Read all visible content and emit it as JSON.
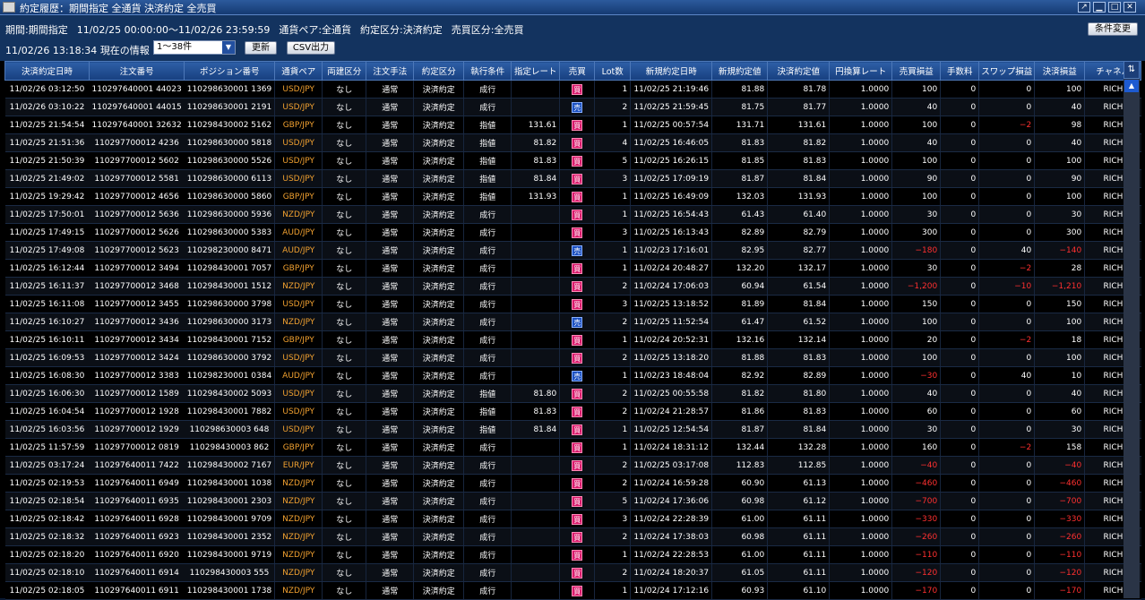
{
  "window": {
    "title": "約定履歴：期間指定 全通貨 決済約定 全売買"
  },
  "info": {
    "period_label": "期間:期間指定",
    "period_range": "11/02/25 00:00:00〜11/02/26 23:59:59",
    "currency": "通貨ペア:全通貨",
    "trade_type": "約定区分:決済約定",
    "side": "売買区分:全売買",
    "current_time": "11/02/26 13:18:34",
    "current_info_label": "現在の情報",
    "range_select": "1〜38件",
    "refresh_button": "更新",
    "csv_button": "CSV出力",
    "condition_button": "条件変更"
  },
  "columns": [
    "決済約定日時",
    "注文番号",
    "ポジション番号",
    "通貨ペア",
    "両建区分",
    "注文手法",
    "約定区分",
    "執行条件",
    "指定レート",
    "売買",
    "Lot数",
    "新規約定日時",
    "新規約定値",
    "決済約定値",
    "円換算レート",
    "売買損益",
    "手数料",
    "スワップ損益",
    "決済損益",
    "チャネル"
  ],
  "rows": [
    {
      "dt": "11/02/26 03:12:50",
      "order": "110297640001 44023",
      "pos": "110298630001 1369",
      "pair": "USD/JPY",
      "hedge": "なし",
      "method": "通常",
      "kind": "決済約定",
      "cond": "成行",
      "rate": "",
      "side": "買",
      "lot": "1",
      "open_dt": "11/02/25 21:19:46",
      "open": "81.88",
      "close": "81.78",
      "conv": "1.0000",
      "pl": "100",
      "fee": "0",
      "swap": "0",
      "net": "100",
      "ch": "RICH"
    },
    {
      "dt": "11/02/26 03:10:22",
      "order": "110297640001 44015",
      "pos": "110298630001 2191",
      "pair": "USD/JPY",
      "hedge": "なし",
      "method": "通常",
      "kind": "決済約定",
      "cond": "成行",
      "rate": "",
      "side": "売",
      "lot": "2",
      "open_dt": "11/02/25 21:59:45",
      "open": "81.75",
      "close": "81.77",
      "conv": "1.0000",
      "pl": "40",
      "fee": "0",
      "swap": "0",
      "net": "40",
      "ch": "RICH"
    },
    {
      "dt": "11/02/25 21:54:54",
      "order": "110297640001 32632",
      "pos": "110298430002 5162",
      "pair": "GBP/JPY",
      "hedge": "なし",
      "method": "通常",
      "kind": "決済約定",
      "cond": "指値",
      "rate": "131.61",
      "side": "買",
      "lot": "1",
      "open_dt": "11/02/25 00:57:54",
      "open": "131.71",
      "close": "131.61",
      "conv": "1.0000",
      "pl": "100",
      "fee": "0",
      "swap": "−2",
      "net": "98",
      "ch": "RICH"
    },
    {
      "dt": "11/02/25 21:51:36",
      "order": "110297700012 4236",
      "pos": "110298630000 5818",
      "pair": "USD/JPY",
      "hedge": "なし",
      "method": "通常",
      "kind": "決済約定",
      "cond": "指値",
      "rate": "81.82",
      "side": "買",
      "lot": "4",
      "open_dt": "11/02/25 16:46:05",
      "open": "81.83",
      "close": "81.82",
      "conv": "1.0000",
      "pl": "40",
      "fee": "0",
      "swap": "0",
      "net": "40",
      "ch": "RICH"
    },
    {
      "dt": "11/02/25 21:50:39",
      "order": "110297700012 5602",
      "pos": "110298630000 5526",
      "pair": "USD/JPY",
      "hedge": "なし",
      "method": "通常",
      "kind": "決済約定",
      "cond": "指値",
      "rate": "81.83",
      "side": "買",
      "lot": "5",
      "open_dt": "11/02/25 16:26:15",
      "open": "81.85",
      "close": "81.83",
      "conv": "1.0000",
      "pl": "100",
      "fee": "0",
      "swap": "0",
      "net": "100",
      "ch": "RICH"
    },
    {
      "dt": "11/02/25 21:49:02",
      "order": "110297700012 5581",
      "pos": "110298630000 6113",
      "pair": "USD/JPY",
      "hedge": "なし",
      "method": "通常",
      "kind": "決済約定",
      "cond": "指値",
      "rate": "81.84",
      "side": "買",
      "lot": "3",
      "open_dt": "11/02/25 17:09:19",
      "open": "81.87",
      "close": "81.84",
      "conv": "1.0000",
      "pl": "90",
      "fee": "0",
      "swap": "0",
      "net": "90",
      "ch": "RICH"
    },
    {
      "dt": "11/02/25 19:29:42",
      "order": "110297700012 4656",
      "pos": "110298630000 5860",
      "pair": "GBP/JPY",
      "hedge": "なし",
      "method": "通常",
      "kind": "決済約定",
      "cond": "指値",
      "rate": "131.93",
      "side": "買",
      "lot": "1",
      "open_dt": "11/02/25 16:49:09",
      "open": "132.03",
      "close": "131.93",
      "conv": "1.0000",
      "pl": "100",
      "fee": "0",
      "swap": "0",
      "net": "100",
      "ch": "RICH"
    },
    {
      "dt": "11/02/25 17:50:01",
      "order": "110297700012 5636",
      "pos": "110298630000 5936",
      "pair": "NZD/JPY",
      "hedge": "なし",
      "method": "通常",
      "kind": "決済約定",
      "cond": "成行",
      "rate": "",
      "side": "買",
      "lot": "1",
      "open_dt": "11/02/25 16:54:43",
      "open": "61.43",
      "close": "61.40",
      "conv": "1.0000",
      "pl": "30",
      "fee": "0",
      "swap": "0",
      "net": "30",
      "ch": "RICH"
    },
    {
      "dt": "11/02/25 17:49:15",
      "order": "110297700012 5626",
      "pos": "110298630000 5383",
      "pair": "AUD/JPY",
      "hedge": "なし",
      "method": "通常",
      "kind": "決済約定",
      "cond": "成行",
      "rate": "",
      "side": "買",
      "lot": "3",
      "open_dt": "11/02/25 16:13:43",
      "open": "82.89",
      "close": "82.79",
      "conv": "1.0000",
      "pl": "300",
      "fee": "0",
      "swap": "0",
      "net": "300",
      "ch": "RICH"
    },
    {
      "dt": "11/02/25 17:49:08",
      "order": "110297700012 5623",
      "pos": "110298230000 8471",
      "pair": "AUD/JPY",
      "hedge": "なし",
      "method": "通常",
      "kind": "決済約定",
      "cond": "成行",
      "rate": "",
      "side": "売",
      "lot": "1",
      "open_dt": "11/02/23 17:16:01",
      "open": "82.95",
      "close": "82.77",
      "conv": "1.0000",
      "pl": "−180",
      "fee": "0",
      "swap": "40",
      "net": "−140",
      "ch": "RICH"
    },
    {
      "dt": "11/02/25 16:12:44",
      "order": "110297700012 3494",
      "pos": "110298430001 7057",
      "pair": "GBP/JPY",
      "hedge": "なし",
      "method": "通常",
      "kind": "決済約定",
      "cond": "成行",
      "rate": "",
      "side": "買",
      "lot": "1",
      "open_dt": "11/02/24 20:48:27",
      "open": "132.20",
      "close": "132.17",
      "conv": "1.0000",
      "pl": "30",
      "fee": "0",
      "swap": "−2",
      "net": "28",
      "ch": "RICH"
    },
    {
      "dt": "11/02/25 16:11:37",
      "order": "110297700012 3468",
      "pos": "110298430001 1512",
      "pair": "NZD/JPY",
      "hedge": "なし",
      "method": "通常",
      "kind": "決済約定",
      "cond": "成行",
      "rate": "",
      "side": "買",
      "lot": "2",
      "open_dt": "11/02/24 17:06:03",
      "open": "60.94",
      "close": "61.54",
      "conv": "1.0000",
      "pl": "−1,200",
      "fee": "0",
      "swap": "−10",
      "net": "−1,210",
      "ch": "RICH"
    },
    {
      "dt": "11/02/25 16:11:08",
      "order": "110297700012 3455",
      "pos": "110298630000 3798",
      "pair": "USD/JPY",
      "hedge": "なし",
      "method": "通常",
      "kind": "決済約定",
      "cond": "成行",
      "rate": "",
      "side": "買",
      "lot": "3",
      "open_dt": "11/02/25 13:18:52",
      "open": "81.89",
      "close": "81.84",
      "conv": "1.0000",
      "pl": "150",
      "fee": "0",
      "swap": "0",
      "net": "150",
      "ch": "RICH"
    },
    {
      "dt": "11/02/25 16:10:27",
      "order": "110297700012 3436",
      "pos": "110298630000 3173",
      "pair": "NZD/JPY",
      "hedge": "なし",
      "method": "通常",
      "kind": "決済約定",
      "cond": "成行",
      "rate": "",
      "side": "売",
      "lot": "2",
      "open_dt": "11/02/25 11:52:54",
      "open": "61.47",
      "close": "61.52",
      "conv": "1.0000",
      "pl": "100",
      "fee": "0",
      "swap": "0",
      "net": "100",
      "ch": "RICH"
    },
    {
      "dt": "11/02/25 16:10:11",
      "order": "110297700012 3434",
      "pos": "110298430001 7152",
      "pair": "GBP/JPY",
      "hedge": "なし",
      "method": "通常",
      "kind": "決済約定",
      "cond": "成行",
      "rate": "",
      "side": "買",
      "lot": "1",
      "open_dt": "11/02/24 20:52:31",
      "open": "132.16",
      "close": "132.14",
      "conv": "1.0000",
      "pl": "20",
      "fee": "0",
      "swap": "−2",
      "net": "18",
      "ch": "RICH"
    },
    {
      "dt": "11/02/25 16:09:53",
      "order": "110297700012 3424",
      "pos": "110298630000 3792",
      "pair": "USD/JPY",
      "hedge": "なし",
      "method": "通常",
      "kind": "決済約定",
      "cond": "成行",
      "rate": "",
      "side": "買",
      "lot": "2",
      "open_dt": "11/02/25 13:18:20",
      "open": "81.88",
      "close": "81.83",
      "conv": "1.0000",
      "pl": "100",
      "fee": "0",
      "swap": "0",
      "net": "100",
      "ch": "RICH"
    },
    {
      "dt": "11/02/25 16:08:30",
      "order": "110297700012 3383",
      "pos": "110298230001 0384",
      "pair": "AUD/JPY",
      "hedge": "なし",
      "method": "通常",
      "kind": "決済約定",
      "cond": "成行",
      "rate": "",
      "side": "売",
      "lot": "1",
      "open_dt": "11/02/23 18:48:04",
      "open": "82.92",
      "close": "82.89",
      "conv": "1.0000",
      "pl": "−30",
      "fee": "0",
      "swap": "40",
      "net": "10",
      "ch": "RICH"
    },
    {
      "dt": "11/02/25 16:06:30",
      "order": "110297700012 1589",
      "pos": "110298430002 5093",
      "pair": "USD/JPY",
      "hedge": "なし",
      "method": "通常",
      "kind": "決済約定",
      "cond": "指値",
      "rate": "81.80",
      "side": "買",
      "lot": "2",
      "open_dt": "11/02/25 00:55:58",
      "open": "81.82",
      "close": "81.80",
      "conv": "1.0000",
      "pl": "40",
      "fee": "0",
      "swap": "0",
      "net": "40",
      "ch": "RICH"
    },
    {
      "dt": "11/02/25 16:04:54",
      "order": "110297700012 1928",
      "pos": "110298430001 7882",
      "pair": "USD/JPY",
      "hedge": "なし",
      "method": "通常",
      "kind": "決済約定",
      "cond": "指値",
      "rate": "81.83",
      "side": "買",
      "lot": "2",
      "open_dt": "11/02/24 21:28:57",
      "open": "81.86",
      "close": "81.83",
      "conv": "1.0000",
      "pl": "60",
      "fee": "0",
      "swap": "0",
      "net": "60",
      "ch": "RICH"
    },
    {
      "dt": "11/02/25 16:03:56",
      "order": "110297700012 1929",
      "pos": "110298630003 648",
      "pair": "USD/JPY",
      "hedge": "なし",
      "method": "通常",
      "kind": "決済約定",
      "cond": "指値",
      "rate": "81.84",
      "side": "買",
      "lot": "1",
      "open_dt": "11/02/25 12:54:54",
      "open": "81.87",
      "close": "81.84",
      "conv": "1.0000",
      "pl": "30",
      "fee": "0",
      "swap": "0",
      "net": "30",
      "ch": "RICH"
    },
    {
      "dt": "11/02/25 11:57:59",
      "order": "110297700012 0819",
      "pos": "110298430003 862",
      "pair": "GBP/JPY",
      "hedge": "なし",
      "method": "通常",
      "kind": "決済約定",
      "cond": "成行",
      "rate": "",
      "side": "買",
      "lot": "1",
      "open_dt": "11/02/24 18:31:12",
      "open": "132.44",
      "close": "132.28",
      "conv": "1.0000",
      "pl": "160",
      "fee": "0",
      "swap": "−2",
      "net": "158",
      "ch": "RICH"
    },
    {
      "dt": "11/02/25 03:17:24",
      "order": "110297640011 7422",
      "pos": "110298430002 7167",
      "pair": "EUR/JPY",
      "hedge": "なし",
      "method": "通常",
      "kind": "決済約定",
      "cond": "成行",
      "rate": "",
      "side": "買",
      "lot": "2",
      "open_dt": "11/02/25 03:17:08",
      "open": "112.83",
      "close": "112.85",
      "conv": "1.0000",
      "pl": "−40",
      "fee": "0",
      "swap": "0",
      "net": "−40",
      "ch": "RICH"
    },
    {
      "dt": "11/02/25 02:19:53",
      "order": "110297640011 6949",
      "pos": "110298430001 1038",
      "pair": "NZD/JPY",
      "hedge": "なし",
      "method": "通常",
      "kind": "決済約定",
      "cond": "成行",
      "rate": "",
      "side": "買",
      "lot": "2",
      "open_dt": "11/02/24 16:59:28",
      "open": "60.90",
      "close": "61.13",
      "conv": "1.0000",
      "pl": "−460",
      "fee": "0",
      "swap": "0",
      "net": "−460",
      "ch": "RICH"
    },
    {
      "dt": "11/02/25 02:18:54",
      "order": "110297640011 6935",
      "pos": "110298430001 2303",
      "pair": "NZD/JPY",
      "hedge": "なし",
      "method": "通常",
      "kind": "決済約定",
      "cond": "成行",
      "rate": "",
      "side": "買",
      "lot": "5",
      "open_dt": "11/02/24 17:36:06",
      "open": "60.98",
      "close": "61.12",
      "conv": "1.0000",
      "pl": "−700",
      "fee": "0",
      "swap": "0",
      "net": "−700",
      "ch": "RICH"
    },
    {
      "dt": "11/02/25 02:18:42",
      "order": "110297640011 6928",
      "pos": "110298430001 9709",
      "pair": "NZD/JPY",
      "hedge": "なし",
      "method": "通常",
      "kind": "決済約定",
      "cond": "成行",
      "rate": "",
      "side": "買",
      "lot": "3",
      "open_dt": "11/02/24 22:28:39",
      "open": "61.00",
      "close": "61.11",
      "conv": "1.0000",
      "pl": "−330",
      "fee": "0",
      "swap": "0",
      "net": "−330",
      "ch": "RICH"
    },
    {
      "dt": "11/02/25 02:18:32",
      "order": "110297640011 6923",
      "pos": "110298430001 2352",
      "pair": "NZD/JPY",
      "hedge": "なし",
      "method": "通常",
      "kind": "決済約定",
      "cond": "成行",
      "rate": "",
      "side": "買",
      "lot": "2",
      "open_dt": "11/02/24 17:38:03",
      "open": "60.98",
      "close": "61.11",
      "conv": "1.0000",
      "pl": "−260",
      "fee": "0",
      "swap": "0",
      "net": "−260",
      "ch": "RICH"
    },
    {
      "dt": "11/02/25 02:18:20",
      "order": "110297640011 6920",
      "pos": "110298430001 9719",
      "pair": "NZD/JPY",
      "hedge": "なし",
      "method": "通常",
      "kind": "決済約定",
      "cond": "成行",
      "rate": "",
      "side": "買",
      "lot": "1",
      "open_dt": "11/02/24 22:28:53",
      "open": "61.00",
      "close": "61.11",
      "conv": "1.0000",
      "pl": "−110",
      "fee": "0",
      "swap": "0",
      "net": "−110",
      "ch": "RICH"
    },
    {
      "dt": "11/02/25 02:18:10",
      "order": "110297640011 6914",
      "pos": "110298430003 555",
      "pair": "NZD/JPY",
      "hedge": "なし",
      "method": "通常",
      "kind": "決済約定",
      "cond": "成行",
      "rate": "",
      "side": "買",
      "lot": "2",
      "open_dt": "11/02/24 18:20:37",
      "open": "61.05",
      "close": "61.11",
      "conv": "1.0000",
      "pl": "−120",
      "fee": "0",
      "swap": "0",
      "net": "−120",
      "ch": "RICH"
    },
    {
      "dt": "11/02/25 02:18:05",
      "order": "110297640011 6911",
      "pos": "110298430001 1738",
      "pair": "NZD/JPY",
      "hedge": "なし",
      "method": "通常",
      "kind": "決済約定",
      "cond": "成行",
      "rate": "",
      "side": "買",
      "lot": "1",
      "open_dt": "11/02/24 17:12:16",
      "open": "60.93",
      "close": "61.10",
      "conv": "1.0000",
      "pl": "−170",
      "fee": "0",
      "swap": "0",
      "net": "−170",
      "ch": "RICH"
    }
  ],
  "colors": {
    "buy": "#d8186a",
    "sell": "#1a4fc0",
    "pair": "#f0a030",
    "negative": "#ff3030"
  },
  "icons": {
    "app": "app-icon",
    "scroll_up": "arrow-up-icon",
    "grid_settings": "column-settings-icon"
  }
}
